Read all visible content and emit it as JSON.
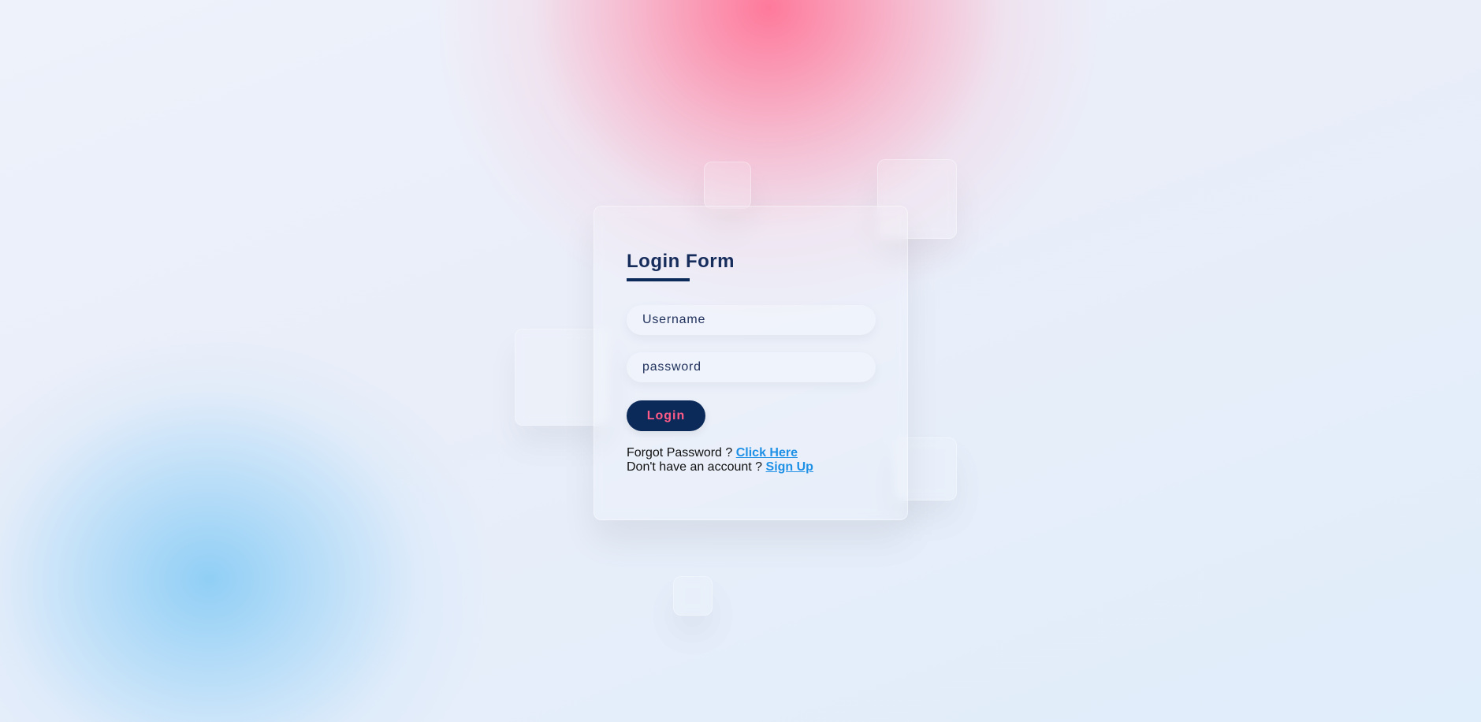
{
  "login_form": {
    "title": "Login Form",
    "username_placeholder": "Username",
    "password_placeholder": "password",
    "login_button": "Login",
    "forgot_password_text": "Forgot Password ? ",
    "forgot_password_link": "Click Here",
    "signup_text": "Don't have an account ? ",
    "signup_link": "Sign Up"
  },
  "colors": {
    "primary": "#0b2a5a",
    "accent": "#ff5b86",
    "link": "#1e90e6",
    "background_pink": "#ff7396",
    "background_blue": "#8ccdf5"
  }
}
